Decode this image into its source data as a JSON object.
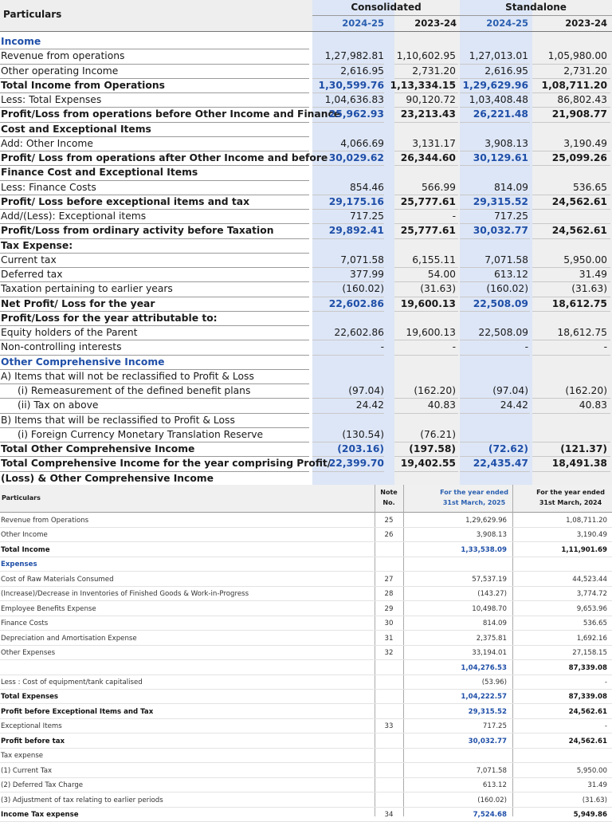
{
  "table1": {
    "header": {
      "particulars": "Particulars",
      "consolidated": "Consolidated",
      "standalone": "Standalone",
      "years": [
        "2024-25",
        "2023-24",
        "2024-25",
        "2023-24"
      ]
    },
    "rows": [
      {
        "label": "Income",
        "style": "blue",
        "values": [
          "",
          "",
          "",
          ""
        ]
      },
      {
        "label": "Revenue from operations",
        "style": "",
        "values": [
          "1,27,982.81",
          "1,10,602.95",
          "1,27,013.01",
          "1,05,980.00"
        ]
      },
      {
        "label": "Other operating Income",
        "style": "",
        "values": [
          "2,616.95",
          "2,731.20",
          "2,616.95",
          "2,731.20"
        ]
      },
      {
        "label": "Total Income from Operations",
        "style": "b",
        "values": [
          "1,30,599.76",
          "1,13,334.15",
          "1,29,629.96",
          "1,08,711.20"
        ]
      },
      {
        "label": "Less: Total Expenses",
        "style": "",
        "values": [
          "1,04,636.83",
          "90,120.72",
          "1,03,408.48",
          "86,802.43"
        ]
      },
      {
        "label": "Profit/Loss from operations before Other Income and Finance",
        "style": "b",
        "values": [
          "25,962.93",
          "23,213.43",
          "26,221.48",
          "21,908.77"
        ]
      },
      {
        "label": "Cost and Exceptional Items",
        "style": "b",
        "values": [
          "",
          "",
          "",
          ""
        ]
      },
      {
        "label": "Add: Other Income",
        "style": "",
        "values": [
          "4,066.69",
          "3,131.17",
          "3,908.13",
          "3,190.49"
        ]
      },
      {
        "label": "Profit/ Loss from operations after Other Income and before",
        "style": "b",
        "values": [
          "30,029.62",
          "26,344.60",
          "30,129.61",
          "25,099.26"
        ]
      },
      {
        "label": "Finance Cost and Exceptional Items",
        "style": "b",
        "values": [
          "",
          "",
          "",
          ""
        ]
      },
      {
        "label": "Less: Finance Costs",
        "style": "",
        "values": [
          "854.46",
          "566.99",
          "814.09",
          "536.65"
        ]
      },
      {
        "label": "Profit/ Loss before exceptional items and tax",
        "style": "b",
        "values": [
          "29,175.16",
          "25,777.61",
          "29,315.52",
          "24,562.61"
        ]
      },
      {
        "label": "Add/(Less): Exceptional items",
        "style": "",
        "values": [
          "717.25",
          "-",
          "717.25",
          ""
        ]
      },
      {
        "label": "Profit/Loss from ordinary activity before Taxation",
        "style": "b",
        "values": [
          "29,892.41",
          "25,777.61",
          "30,032.77",
          "24,562.61"
        ]
      },
      {
        "label": "Tax Expense:",
        "style": "b",
        "values": [
          "",
          "",
          "",
          ""
        ]
      },
      {
        "label": "Current tax",
        "style": "",
        "values": [
          "7,071.58",
          "6,155.11",
          "7,071.58",
          "5,950.00"
        ]
      },
      {
        "label": "Deferred tax",
        "style": "",
        "values": [
          "377.99",
          "54.00",
          "613.12",
          "31.49"
        ]
      },
      {
        "label": "Taxation pertaining to earlier years",
        "style": "",
        "values": [
          "(160.02)",
          "(31.63)",
          "(160.02)",
          "(31.63)"
        ]
      },
      {
        "label": "Net Profit/ Loss for the year",
        "style": "b",
        "values": [
          "22,602.86",
          "19,600.13",
          "22,508.09",
          "18,612.75"
        ]
      },
      {
        "label": "Profit/Loss for the year attributable to:",
        "style": "b",
        "values": [
          "",
          "",
          "",
          ""
        ]
      },
      {
        "label": "Equity holders of the Parent",
        "style": "",
        "values": [
          "22,602.86",
          "19,600.13",
          "22,508.09",
          "18,612.75"
        ]
      },
      {
        "label": "Non-controlling interests",
        "style": "",
        "values": [
          "-",
          "-",
          "-",
          "-"
        ]
      },
      {
        "label": "Other Comprehensive Income",
        "style": "blue",
        "values": [
          "",
          "",
          "",
          ""
        ]
      },
      {
        "label": "A)  Items that will not be reclassified to Profit & Loss",
        "style": "",
        "values": [
          "",
          "",
          "",
          ""
        ]
      },
      {
        "label": "(i)  Remeasurement of the defined benefit plans",
        "style": "ind",
        "values": [
          "(97.04)",
          "(162.20)",
          "(97.04)",
          "(162.20)"
        ]
      },
      {
        "label": "(ii)  Tax on above",
        "style": "ind",
        "values": [
          "24.42",
          "40.83",
          "24.42",
          "40.83"
        ]
      },
      {
        "label": "B)  Items that will be reclassified to Profit & Loss",
        "style": "",
        "values": [
          "",
          "",
          "",
          ""
        ]
      },
      {
        "label": "(i)  Foreign Currency Monetary Translation Reserve",
        "style": "ind",
        "values": [
          "(130.54)",
          "(76.21)",
          "",
          ""
        ]
      },
      {
        "label": "Total Other Comprehensive Income",
        "style": "b",
        "values": [
          "(203.16)",
          "(197.58)",
          "(72.62)",
          "(121.37)"
        ]
      },
      {
        "label": "Total Comprehensive Income for the year comprising Profit/",
        "style": "b",
        "values": [
          "22,399.70",
          "19,402.55",
          "22,435.47",
          "18,491.38"
        ]
      },
      {
        "label": "(Loss) & Other Comprehensive Income",
        "style": "b",
        "values": [
          "",
          "",
          "",
          ""
        ]
      }
    ]
  },
  "table2": {
    "header": {
      "particulars": "Particulars",
      "note": [
        "Note",
        "No."
      ],
      "col1": [
        "For the year ended",
        "31st March, 2025"
      ],
      "col2": [
        "For the year ended",
        "31st March, 2024"
      ]
    },
    "rows": [
      {
        "label": "Revenue from Operations",
        "style": "",
        "note": "25",
        "values": [
          "1,29,629.96",
          "1,08,711.20"
        ]
      },
      {
        "label": "Other Income",
        "style": "",
        "note": "26",
        "values": [
          "3,908.13",
          "3,190.49"
        ]
      },
      {
        "label": "Total Income",
        "style": "b",
        "note": "",
        "values": [
          "1,33,538.09",
          "1,11,901.69"
        ]
      },
      {
        "label": "Expenses",
        "style": "blue",
        "note": "",
        "values": [
          "",
          ""
        ]
      },
      {
        "label": "Cost of Raw Materials Consumed",
        "style": "",
        "note": "27",
        "values": [
          "57,537.19",
          "44,523.44"
        ]
      },
      {
        "label": "(Increase)/Decrease in Inventories of Finished Goods & Work-in-Progress",
        "style": "",
        "note": "28",
        "values": [
          "(143.27)",
          "3,774.72"
        ]
      },
      {
        "label": "Employee Benefits Expense",
        "style": "",
        "note": "29",
        "values": [
          "10,498.70",
          "9,653.96"
        ]
      },
      {
        "label": "Finance Costs",
        "style": "",
        "note": "30",
        "values": [
          "814.09",
          "536.65"
        ]
      },
      {
        "label": "Depreciation and Amortisation Expense",
        "style": "",
        "note": "31",
        "values": [
          "2,375.81",
          "1,692.16"
        ]
      },
      {
        "label": "Other Expenses",
        "style": "",
        "note": "32",
        "values": [
          "33,194.01",
          "27,158.15"
        ]
      },
      {
        "label": "",
        "style": "",
        "note": "",
        "values": [
          "1,04,276.53",
          "87,339.08"
        ]
      },
      {
        "label": "Less : Cost of equipment/tank capitalised",
        "style": "",
        "note": "",
        "values": [
          "(53.96)",
          "-"
        ]
      },
      {
        "label": "Total Expenses",
        "style": "b",
        "note": "",
        "values": [
          "1,04,222.57",
          "87,339.08"
        ]
      },
      {
        "label": "Profit before Exceptional Items and Tax",
        "style": "b",
        "note": "",
        "values": [
          "29,315.52",
          "24,562.61"
        ]
      },
      {
        "label": "Exceptional Items",
        "style": "",
        "note": "33",
        "values": [
          "717.25",
          "-"
        ]
      },
      {
        "label": "Profit before tax",
        "style": "b",
        "note": "",
        "values": [
          "30,032.77",
          "24,562.61"
        ]
      },
      {
        "label": "Tax expense",
        "style": "",
        "note": "",
        "values": [
          "",
          ""
        ]
      },
      {
        "label": "(1)  Current Tax",
        "style": "",
        "note": "",
        "values": [
          "7,071.58",
          "5,950.00"
        ]
      },
      {
        "label": "(2)  Deferred Tax Charge",
        "style": "",
        "note": "",
        "values": [
          "613.12",
          "31.49"
        ]
      },
      {
        "label": "(3)  Adjustment of tax relating to earlier periods",
        "style": "",
        "note": "",
        "values": [
          "(160.02)",
          "(31.63)"
        ]
      },
      {
        "label": "Income Tax expense",
        "style": "b",
        "note": "34",
        "values": [
          "7,524.68",
          "5,949.86"
        ]
      }
    ]
  },
  "colors": {
    "accent_blue": "#1f4fa8",
    "col_blue_bg": "#dde6f6",
    "col_grey_bg": "#efefef"
  }
}
